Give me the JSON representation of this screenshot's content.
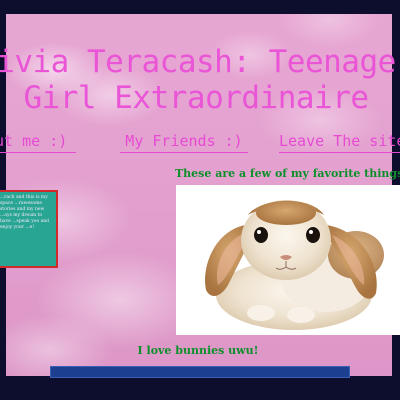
{
  "header": {
    "title_line1": "ivia Teracash: Teenage",
    "title_line2": "Girl Extraordinaire"
  },
  "nav": {
    "about": "out me :)",
    "friends": "My Friends :)",
    "leave": "Leave The site"
  },
  "intro": {
    "text": "...rach and this is my space ...rawesome stories and my new ...ays my dream to have ...speak yoo and enjoy your ...e!"
  },
  "main": {
    "favorites_heading": "These are a few of my favorite things!",
    "photo_caption": "I love bunnies uwu!"
  },
  "colors": {
    "background": "#e3a0cf",
    "title": "#ea54d6",
    "heading_green": "#0d8f2a",
    "intro_box": "#29a594",
    "intro_border": "#d12a2a",
    "frame": "#0d0d2e",
    "bottom_bar": "#1c3f8f"
  }
}
